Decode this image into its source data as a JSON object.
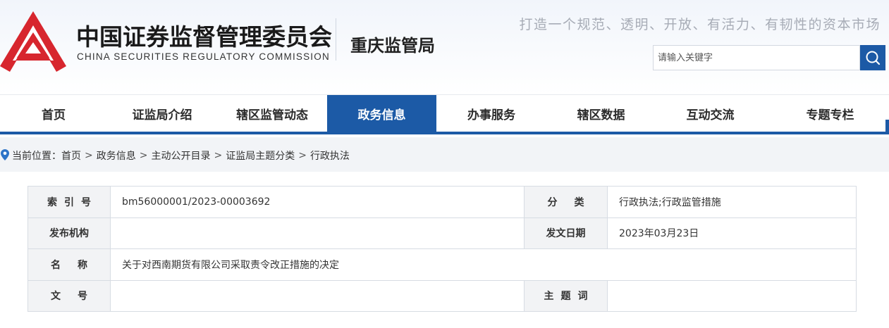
{
  "header": {
    "org_name_cn": "中国证券监督管理委员会",
    "org_name_en": "CHINA SECURITIES REGULATORY COMMISSION",
    "bureau": "重庆监管局",
    "slogan": "打造一个规范、透明、开放、有活力、有韧性的资本市场",
    "search_placeholder": "请输入关键字",
    "logo_icon": "csrc-logo-icon",
    "search_icon": "search-icon",
    "brand_color": "#1c5aa6",
    "logo_color": "#d7262e"
  },
  "nav": {
    "items": [
      {
        "label": "首页"
      },
      {
        "label": "证监局介绍"
      },
      {
        "label": "辖区监管动态"
      },
      {
        "label": "政务信息"
      },
      {
        "label": "办事服务"
      },
      {
        "label": "辖区数据"
      },
      {
        "label": "互动交流"
      },
      {
        "label": "专题专栏"
      }
    ],
    "active": "政务信息"
  },
  "breadcrumb": {
    "prefix": "当前位置：",
    "items": [
      "首页",
      "政务信息",
      "主动公开目录",
      "证监局主题分类",
      "行政执法"
    ],
    "separator": ">",
    "icon": "location-pin-icon"
  },
  "info": {
    "index_label": "索引号",
    "index_value": "bm56000001/2023-00003692",
    "category_label": "分类",
    "category_value": "行政执法;行政监管措施",
    "publisher_label": "发布机构",
    "publisher_value": "",
    "date_label": "发文日期",
    "date_value": "2023年03月23日",
    "title_label": "名称",
    "title_value": "关于对西南期货有限公司采取责令改正措施的决定",
    "docno_label": "文号",
    "docno_value": "",
    "keywords_label": "主题词",
    "keywords_value": ""
  }
}
